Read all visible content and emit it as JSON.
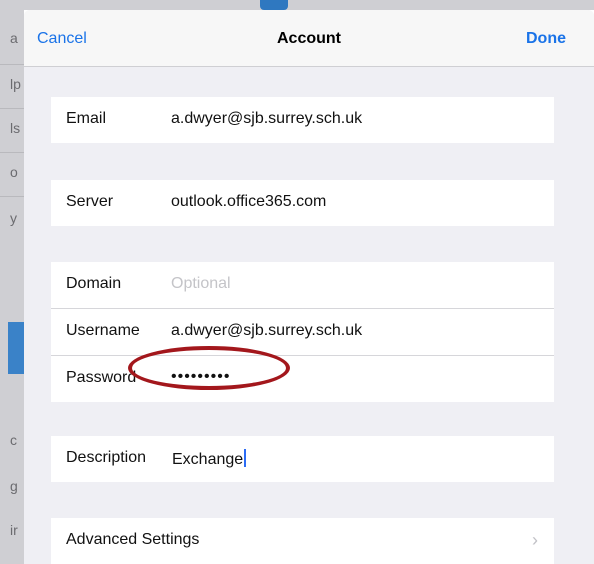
{
  "background_app": {
    "visible_letters": [
      "a",
      "lp",
      "ls",
      "o",
      "y",
      "c",
      "g",
      "ir"
    ]
  },
  "navbar": {
    "cancel_label": "Cancel",
    "title": "Account",
    "done_label": "Done"
  },
  "email": {
    "label": "Email",
    "value": "a.dwyer@sjb.surrey.sch.uk"
  },
  "server": {
    "label": "Server",
    "value": "outlook.office365.com"
  },
  "domain": {
    "label": "Domain",
    "placeholder": "Optional"
  },
  "username": {
    "label": "Username",
    "value": "a.dwyer@sjb.surrey.sch.uk"
  },
  "password": {
    "label": "Password",
    "value": "•••••••••"
  },
  "description": {
    "label": "Description",
    "value": "Exchange"
  },
  "advanced": {
    "label": "Advanced Settings",
    "chevron": "›"
  },
  "colors": {
    "accent": "#1a73e8",
    "annotation": "#a3171c",
    "background": "#efeff4"
  },
  "icons": {
    "advanced_chevron": "chevron-right-icon"
  }
}
